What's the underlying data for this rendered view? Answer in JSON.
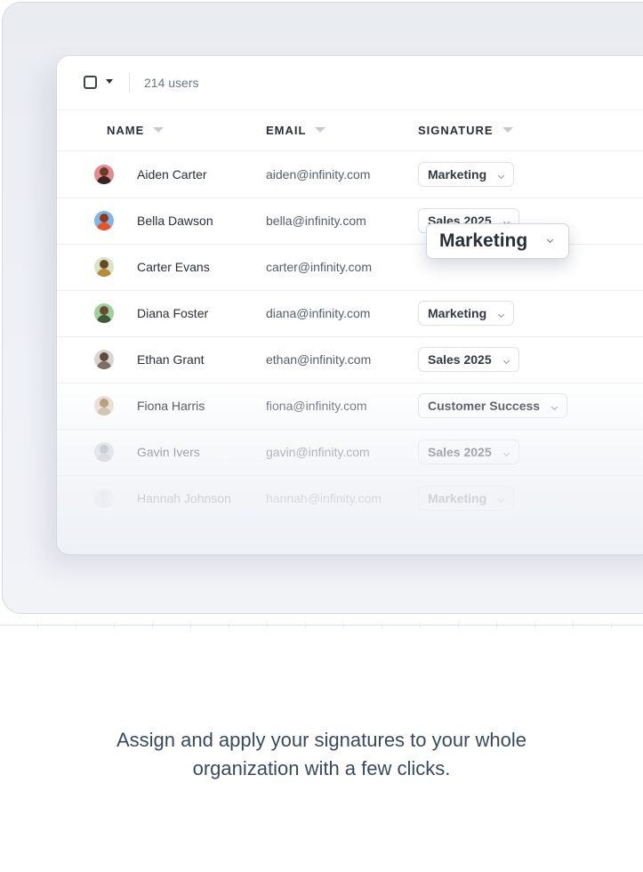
{
  "toolbar": {
    "user_count": "214 users"
  },
  "columns": {
    "name": "NAME",
    "email": "EMAIL",
    "signature": "SIGNATURE"
  },
  "rows": [
    {
      "name": "Aiden Carter",
      "email": "aiden@infinity.com",
      "signature": "Marketing"
    },
    {
      "name": "Bella Dawson",
      "email": "bella@infinity.com",
      "signature": "Sales 2025"
    },
    {
      "name": "Carter Evans",
      "email": "carter@infinity.com",
      "signature": ""
    },
    {
      "name": "Diana Foster",
      "email": "diana@infinity.com",
      "signature": "Marketing"
    },
    {
      "name": "Ethan Grant",
      "email": "ethan@infinity.com",
      "signature": "Sales 2025"
    },
    {
      "name": "Fiona Harris",
      "email": "fiona@infinity.com",
      "signature": "Customer Success"
    },
    {
      "name": "Gavin Ivers",
      "email": "gavin@infinity.com",
      "signature": "Sales 2025"
    },
    {
      "name": "Hannah Johnson",
      "email": "hannah@infinity.com",
      "signature": "Marketing"
    }
  ],
  "dragged_signature": {
    "label": "Marketing"
  },
  "caption": "Assign and apply your signatures to your whole organization with a few clicks."
}
